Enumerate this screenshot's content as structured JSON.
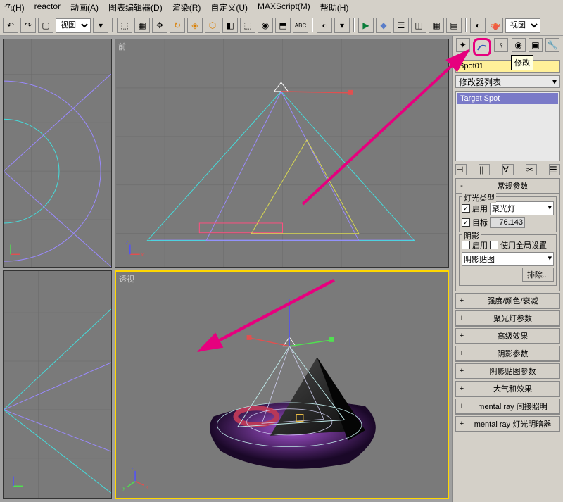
{
  "menus": [
    "色(H)",
    "reactor",
    "动画(A)",
    "图表编辑器(D)",
    "渲染(R)",
    "自定义(U)",
    "MAXScript(M)",
    "帮助(H)"
  ],
  "toolbar": {
    "view_label1": "视图",
    "view_label2": "视图"
  },
  "viewports": {
    "top": "",
    "front": "前",
    "left": "",
    "perspective": "透视"
  },
  "panel": {
    "obj_name": "Spot01",
    "tooltip": "修改",
    "mod_list_label": "修改器列表",
    "mod_item": "Target Spot",
    "rollouts": {
      "general": {
        "title": "常规参数",
        "light_type_grp": "灯光类型",
        "enable": "启用",
        "light_select": "聚光灯",
        "target": "目标",
        "target_dist": "76.143",
        "shadow_grp": "阴影",
        "use_global": "使用全局设置",
        "shadow_type": "阴影贴图",
        "exclude": "排除..."
      },
      "collapsed": [
        "强度/颜色/衰减",
        "聚光灯参数",
        "高级效果",
        "阴影参数",
        "阴影贴图参数",
        "大气和效果",
        "mental ray 间接照明",
        "mental ray 灯光明暗器"
      ]
    }
  }
}
